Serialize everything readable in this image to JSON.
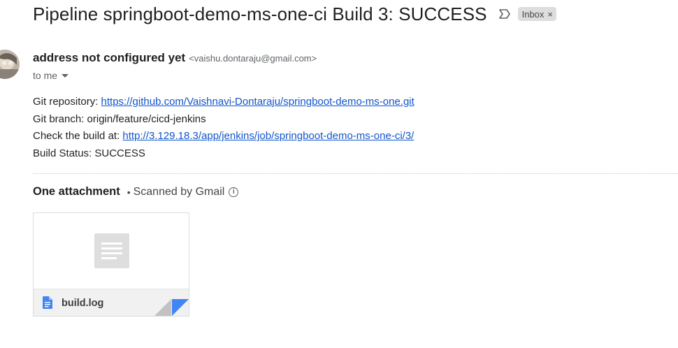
{
  "email": {
    "subject": "Pipeline springboot-demo-ms-one-ci Build 3: SUCCESS",
    "label_badge": "Inbox",
    "label_remove": "×",
    "sender_name": "address not configured yet",
    "sender_email": "<vaishu.dontaraju@gmail.com>",
    "recipient_text": "to me"
  },
  "body": {
    "repo_label": "Git repository: ",
    "repo_link": "https://github.com/Vaishnavi-Dontaraju/springboot-demo-ms-one.git",
    "branch_line": "Git branch: origin/feature/cicd-jenkins",
    "build_label": "Check the build at: ",
    "build_link": "http://3.129.18.3/app/jenkins/job/springboot-demo-ms-one-ci/3/",
    "status_line": "Build Status: SUCCESS"
  },
  "attachments": {
    "header": "One attachment",
    "separator": "•",
    "scanned_text": "Scanned by Gmail",
    "info_glyph": "i",
    "files": [
      {
        "name": "build.log",
        "icon": "google-docs-file-icon"
      }
    ]
  },
  "colors": {
    "link": "#1155cc",
    "file_icon": "#4285f4",
    "badge_bg": "#dddddd"
  }
}
